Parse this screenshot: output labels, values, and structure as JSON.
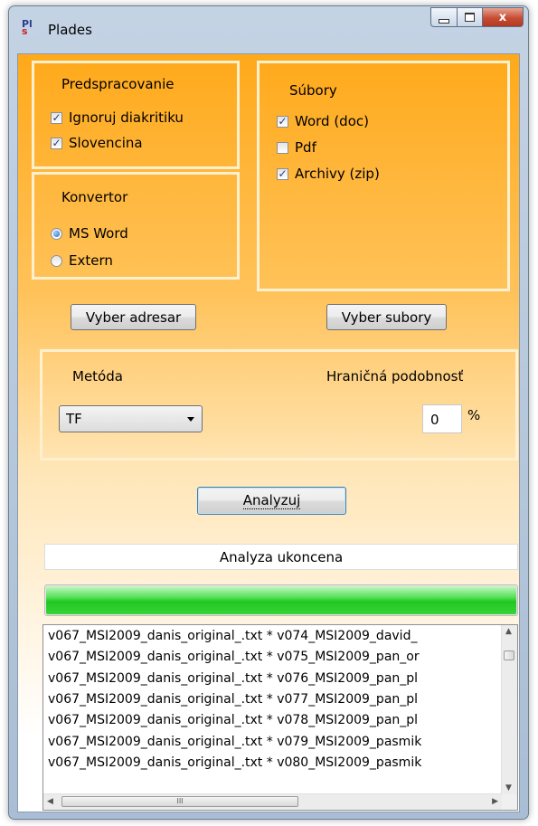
{
  "window": {
    "title": "Plades",
    "icon_text_top": "Pl",
    "icon_text_bottom": "s",
    "close_glyph": "x"
  },
  "preprocessing": {
    "label": "Predspracovanie",
    "options": [
      {
        "label": "Ignoruj diakritiku",
        "checked": true
      },
      {
        "label": "Slovencina",
        "checked": true
      }
    ]
  },
  "files": {
    "label": "Súbory",
    "options": [
      {
        "label": "Word (doc)",
        "checked": true
      },
      {
        "label": "Pdf",
        "checked": false
      },
      {
        "label": "Archivy (zip)",
        "checked": true
      }
    ]
  },
  "converter": {
    "label": "Konvertor",
    "options": [
      {
        "label": "MS Word",
        "selected": true
      },
      {
        "label": "Extern",
        "selected": false
      }
    ]
  },
  "buttons": {
    "select_folder": "Vyber adresar",
    "select_files": "Vyber subory",
    "analyze": "Analyzuj"
  },
  "method": {
    "label": "Metóda",
    "selected": "TF",
    "threshold_label": "Hraničná podobnosť",
    "threshold_value": "0",
    "unit": "%"
  },
  "status_text": "Analyza ukoncena",
  "progress": {
    "percent": 100,
    "color": "#2ecc2e"
  },
  "results": [
    "v067_MSI2009_danis_original_.txt * v074_MSI2009_david_",
    "v067_MSI2009_danis_original_.txt * v075_MSI2009_pan_or",
    "v067_MSI2009_danis_original_.txt * v076_MSI2009_pan_pl",
    "v067_MSI2009_danis_original_.txt * v077_MSI2009_pan_pl",
    "v067_MSI2009_danis_original_.txt * v078_MSI2009_pan_pl",
    "v067_MSI2009_danis_original_.txt * v079_MSI2009_pasmik",
    "v067_MSI2009_danis_original_.txt * v080_MSI2009_pasmik"
  ],
  "scroll": {
    "up": "▲",
    "down": "▼",
    "left": "◀",
    "right": "▶",
    "grip": "III"
  }
}
